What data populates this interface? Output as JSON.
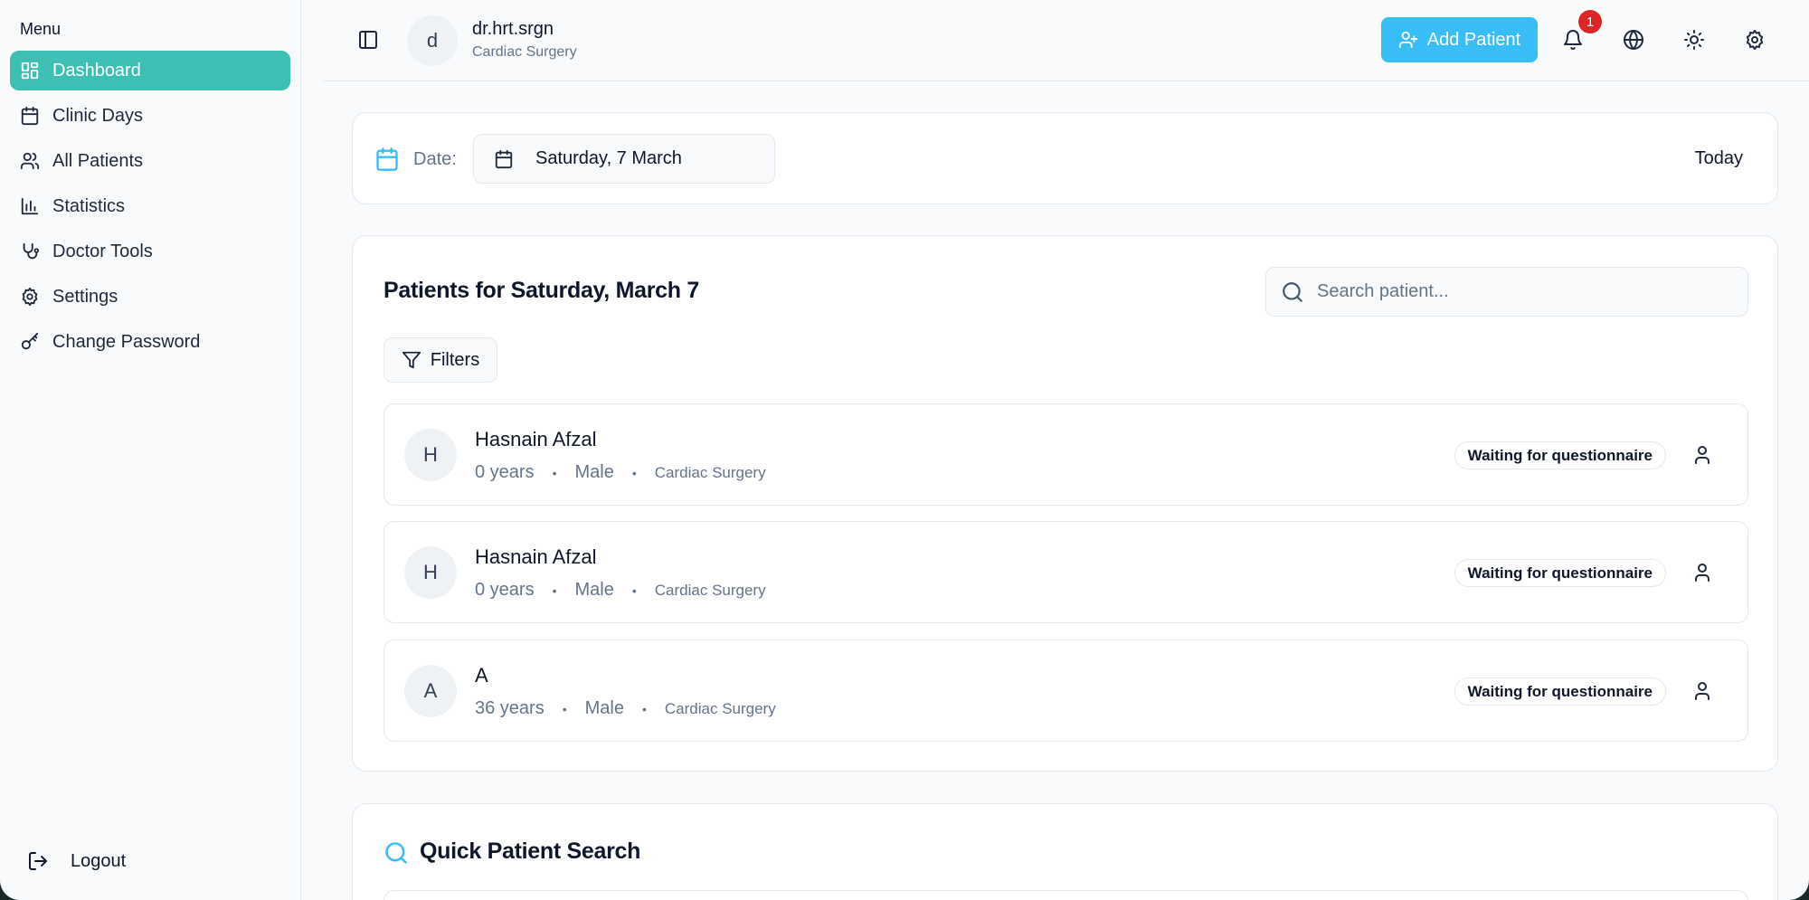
{
  "sidebar": {
    "menu_label": "Menu",
    "items": [
      {
        "label": "Dashboard",
        "icon": "dashboard-icon",
        "active": true
      },
      {
        "label": "Clinic Days",
        "icon": "calendar-icon"
      },
      {
        "label": "All Patients",
        "icon": "users-icon"
      },
      {
        "label": "Statistics",
        "icon": "bar-chart-icon"
      },
      {
        "label": "Doctor Tools",
        "icon": "stethoscope-icon"
      },
      {
        "label": "Settings",
        "icon": "gear-icon"
      },
      {
        "label": "Change Password",
        "icon": "key-icon"
      }
    ],
    "logout_label": "Logout"
  },
  "header": {
    "avatar_initial": "d",
    "user_name": "dr.hrt.srgn",
    "user_specialty": "Cardiac Surgery",
    "add_patient_label": "Add Patient",
    "notification_count": "1"
  },
  "date_bar": {
    "label": "Date:",
    "selected_date": "Saturday, 7 March",
    "today_label": "Today"
  },
  "patients": {
    "title": "Patients for Saturday, March 7",
    "search_placeholder": "Search patient...",
    "filters_label": "Filters",
    "rows": [
      {
        "initial": "H",
        "name": "Hasnain Afzal",
        "age": "0 years",
        "gender": "Male",
        "specialty": "Cardiac Surgery",
        "status": "Waiting for questionnaire"
      },
      {
        "initial": "H",
        "name": "Hasnain Afzal",
        "age": "0 years",
        "gender": "Male",
        "specialty": "Cardiac Surgery",
        "status": "Waiting for questionnaire"
      },
      {
        "initial": "A",
        "name": "A",
        "age": "36 years",
        "gender": "Male",
        "specialty": "Cardiac Surgery",
        "status": "Waiting for questionnaire"
      }
    ]
  },
  "quick_search": {
    "title": "Quick Patient Search"
  },
  "colors": {
    "accent_teal": "#3dbfb3",
    "button_blue": "#38bdf8",
    "badge_red": "#dc2626"
  }
}
